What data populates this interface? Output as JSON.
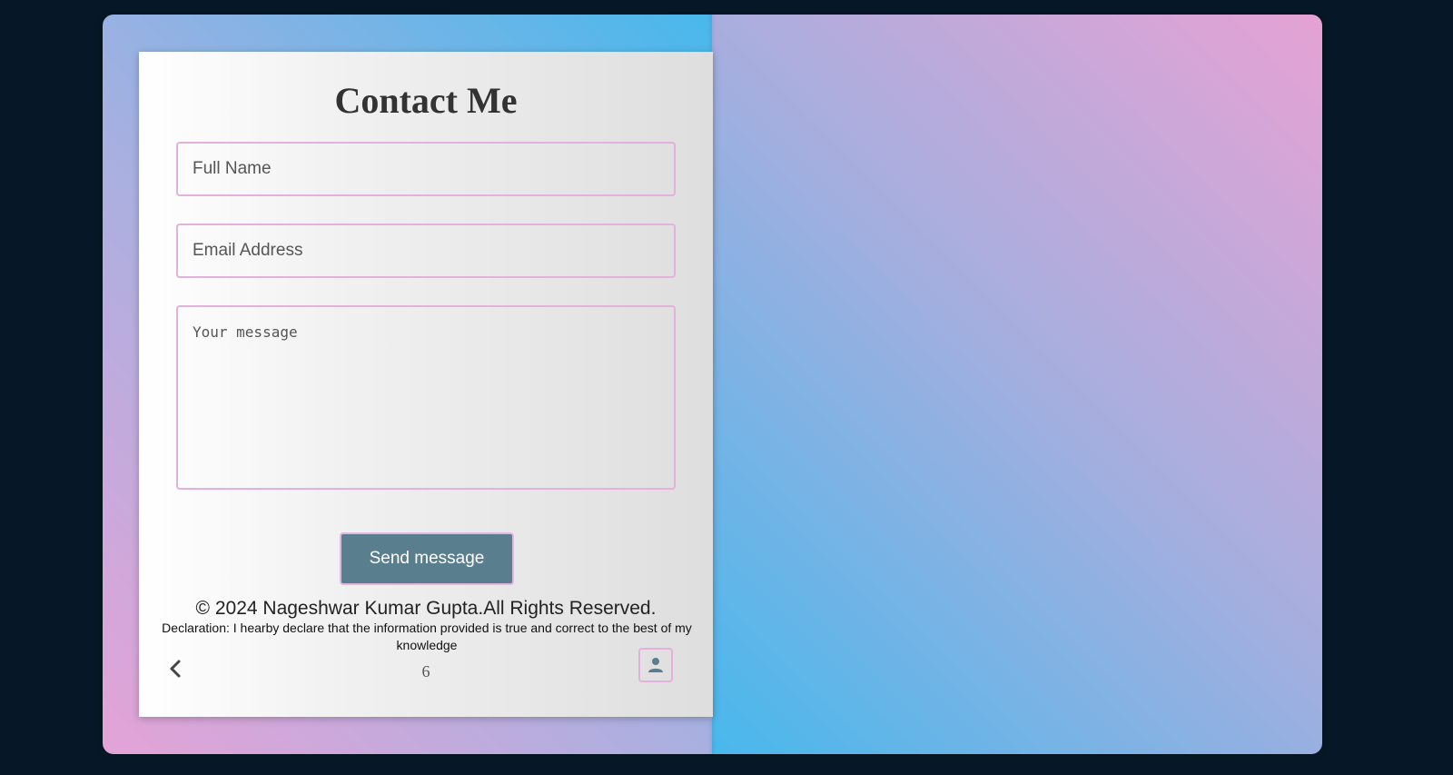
{
  "contact": {
    "title": "Contact Me",
    "name_placeholder": "Full Name",
    "email_placeholder": "Email Address",
    "message_placeholder": "Your message",
    "send_label": "Send message"
  },
  "footer": {
    "copyright": "© 2024 Nageshwar Kumar Gupta.All Rights Reserved.",
    "declaration": "Declaration: I hearby declare that the information provided is true and correct to the best of my knowledge"
  },
  "navigation": {
    "page_number": "6",
    "prev_icon": "chevron-left-icon",
    "profile_icon": "user-icon"
  },
  "colors": {
    "background": "#061827",
    "button": "#597f8f",
    "field_border": "#e2b2dc",
    "gradient_blue": "#48b8ec",
    "gradient_pink": "#e4a3d7"
  }
}
